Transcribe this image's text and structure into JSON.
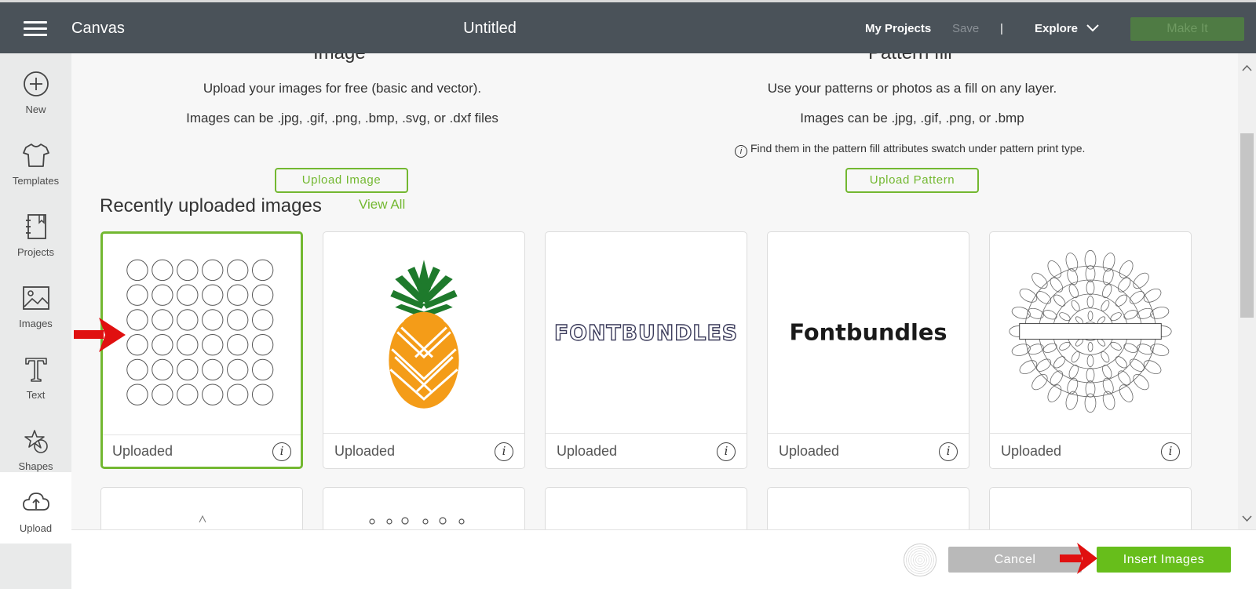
{
  "header": {
    "app_title": "Canvas",
    "doc_title": "Untitled",
    "my_projects": "My Projects",
    "save": "Save",
    "separator": "|",
    "explore": "Explore",
    "make_it": "Make It"
  },
  "sidebar": {
    "items": [
      {
        "label": "New",
        "icon": "plus-circle-icon"
      },
      {
        "label": "Templates",
        "icon": "tshirt-icon"
      },
      {
        "label": "Projects",
        "icon": "notebook-icon"
      },
      {
        "label": "Images",
        "icon": "image-icon"
      },
      {
        "label": "Text",
        "icon": "text-t-icon"
      },
      {
        "label": "Shapes",
        "icon": "shapes-icon"
      },
      {
        "label": "Upload",
        "icon": "cloud-upload-icon"
      }
    ],
    "active": "Upload"
  },
  "upload_image": {
    "title": "Image",
    "line1": "Upload your images for free (basic and vector).",
    "line2": "Images can be .jpg, .gif, .png, .bmp, .svg, or .dxf files",
    "button": "Upload Image"
  },
  "pattern_fill": {
    "title": "Pattern fill",
    "line1": "Use your patterns or photos as a fill on any layer.",
    "line2": "Images can be .jpg, .gif, .png, or .bmp",
    "note": "Find them in the pattern fill attributes swatch under pattern print type.",
    "button": "Upload Pattern"
  },
  "recent": {
    "title": "Recently uploaded images",
    "view_all": "View All",
    "cards": [
      {
        "label": "Uploaded",
        "thumb": "circle-grid",
        "selected": true
      },
      {
        "label": "Uploaded",
        "thumb": "pineapple",
        "selected": false
      },
      {
        "label": "Uploaded",
        "thumb": "fontbundles-outline",
        "text": "FONTBUNDLES",
        "selected": false
      },
      {
        "label": "Uploaded",
        "thumb": "fontbundles-bold",
        "text": "Fontbundles",
        "selected": false
      },
      {
        "label": "Uploaded",
        "thumb": "mandala",
        "selected": false
      }
    ]
  },
  "footer": {
    "cancel": "Cancel",
    "insert": "Insert Images"
  },
  "colors": {
    "accent": "#73b831",
    "topbar": "#4a5259",
    "insert_button": "#67be1b",
    "arrow": "#e01010"
  }
}
